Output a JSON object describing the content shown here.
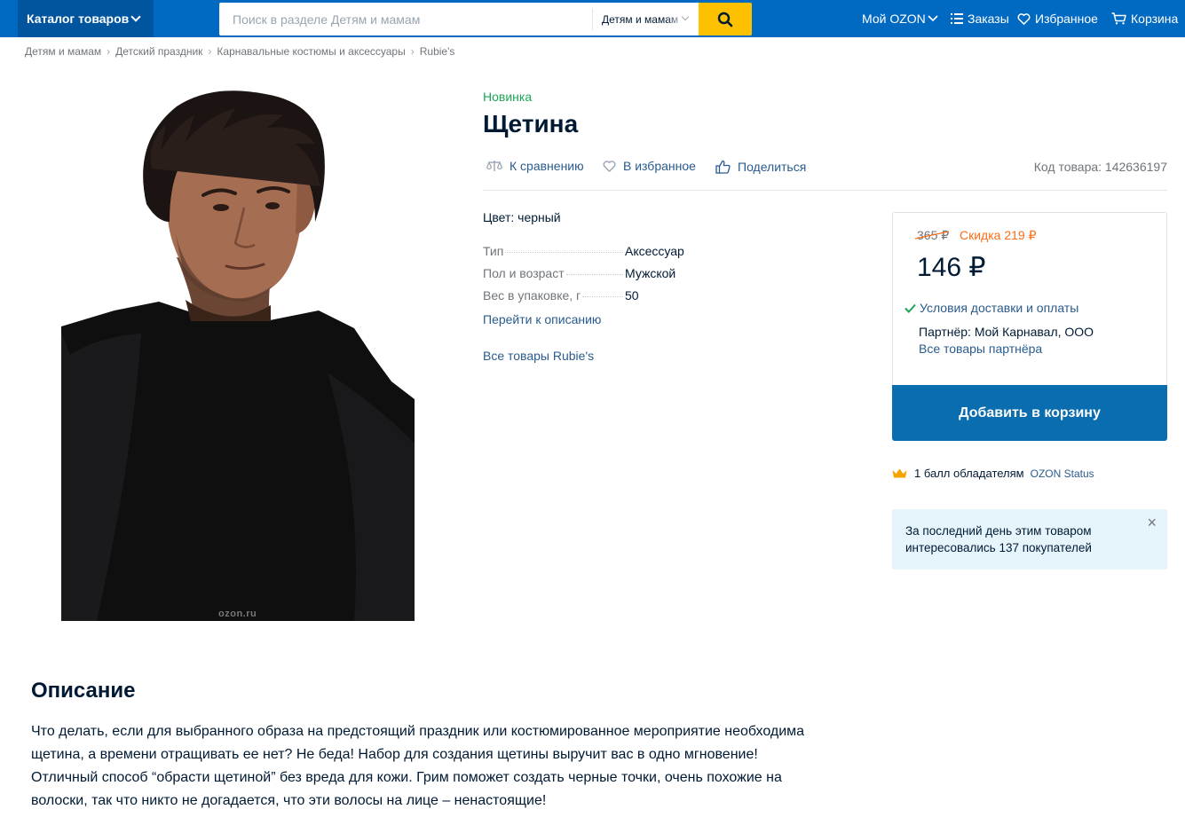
{
  "header": {
    "catalog_label": "Каталог товаров",
    "search_placeholder": "Поиск в разделе Детям и мамам",
    "search_category": "Детям и мамам",
    "nav": {
      "my_ozon": "Мой OZON",
      "orders": "Заказы",
      "favorites": "Избранное",
      "cart": "Корзина"
    }
  },
  "breadcrumbs": [
    "Детям и мамам",
    "Детский праздник",
    "Карнавальные костюмы и аксессуары",
    "Rubie's"
  ],
  "product": {
    "image_watermark": "ozon.ru",
    "badge": "Новинка",
    "title": "Щетина",
    "actions": {
      "compare": "К сравнению",
      "favorite": "В избранное",
      "share": "Поделиться"
    },
    "sku": "Код товара: 142636197",
    "color": "Цвет: черный",
    "specs": [
      {
        "name": "Тип",
        "value": "Аксессуар"
      },
      {
        "name": "Пол и возраст",
        "value": "Мужской"
      },
      {
        "name": "Вес в упаковке, г",
        "value": "50"
      }
    ],
    "go_to_description": "Перейти к описанию",
    "brand_link": "Все товары Rubie's"
  },
  "buy_box": {
    "old_price": "365 ₽",
    "discount": "Скидка 219 ₽",
    "price": "146 ₽",
    "delivery": "Условия доставки и оплаты",
    "partner": "Партнёр: Мой Карнавал, ООО",
    "partner_link": "Все товары партнёра",
    "add_to_cart": "Добавить в корзину"
  },
  "points": {
    "text": "1 балл обладателям",
    "status_link": "OZON Status"
  },
  "notice": {
    "text": "За последний день этим товаром интересовались 137 покупателей",
    "close": "×"
  },
  "description": {
    "title": "Описание",
    "text": "Что делать, если для выбранного образа на предстоящий праздник или костюмированное мероприятие необходима щетина, а времени отращивать ее нет? Не беда! Набор для создания щетины выручит вас в одно мгновение! Отличный способ “обрасти щетиной” без вреда для кожи. Грим поможет создать черные точки, очень похожие на волоски, так что никто не догадается, что эти волосы на лице – ненастоящие!"
  },
  "colors": {
    "header_bg": "#0069c2",
    "search_button": "#fec100",
    "link": "#2a5b8d",
    "discount": "#f96e17",
    "new_badge": "#1da558",
    "cart_button": "#0a6db0",
    "notice_bg": "#e6f4fc"
  },
  "icons": [
    "chevron-down-icon",
    "search-icon",
    "list-icon",
    "heart-icon",
    "cart-icon",
    "scales-icon",
    "thumbs-up-icon",
    "check-icon",
    "crown-icon",
    "close-icon"
  ]
}
